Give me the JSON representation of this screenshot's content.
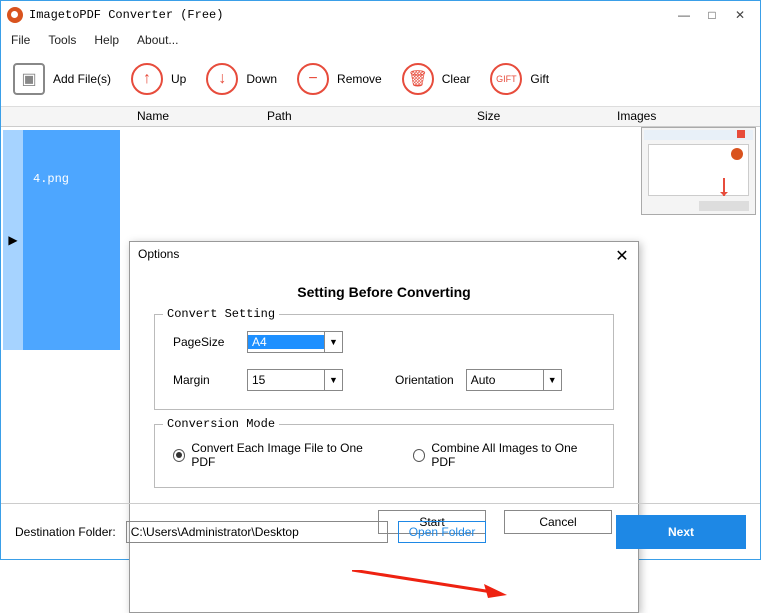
{
  "title": "ImagetoPDF Converter (Free)",
  "menus": {
    "file": "File",
    "tools": "Tools",
    "help": "Help",
    "about": "About..."
  },
  "toolbar": {
    "add": "Add File(s)",
    "up": "Up",
    "down": "Down",
    "remove": "Remove",
    "clear": "Clear",
    "gift": "Gift"
  },
  "headers": {
    "name": "Name",
    "path": "Path",
    "size": "Size",
    "images": "Images"
  },
  "file": {
    "name": "4.png"
  },
  "dialog": {
    "title": "Options",
    "heading": "Setting Before Converting",
    "convert_legend": "Convert Setting",
    "pagesize_label": "PageSize",
    "pagesize_value": "A4",
    "margin_label": "Margin",
    "margin_value": "15",
    "orientation_label": "Orientation",
    "orientation_value": "Auto",
    "mode_legend": "Conversion Mode",
    "mode_each": "Convert Each Image File to One PDF",
    "mode_combine": "Combine All Images to One PDF",
    "start": "Start",
    "cancel": "Cancel"
  },
  "footer": {
    "dest_label": "Destination Folder:",
    "dest_value": "C:\\Users\\Administrator\\Desktop",
    "open_folder": "Open Folder",
    "next": "Next"
  }
}
